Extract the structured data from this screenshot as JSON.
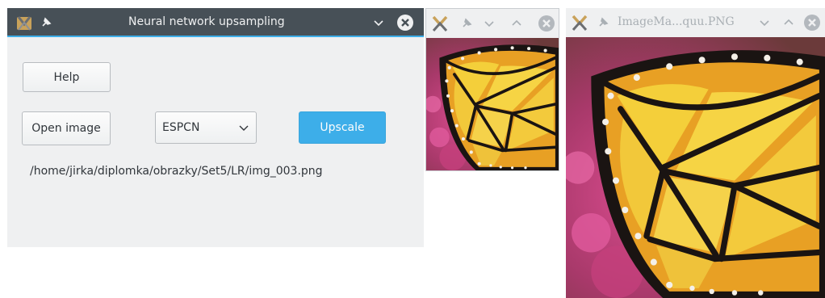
{
  "main_window": {
    "title": "Neural network upsampling",
    "help_button": "Help",
    "open_image_button": "Open image",
    "model_select": {
      "selected": "ESPCN"
    },
    "upscale_button": "Upscale",
    "image_path": "/home/jirka/diplomka/obrazky/Set5/LR/img_003.png"
  },
  "image_window_small": {
    "title": ""
  },
  "image_window_large": {
    "title": "ImageMa...quu.PNG"
  },
  "colors": {
    "accent": "#3daee9",
    "titlebar_dark": "#475057",
    "window_bg": "#eff0f1",
    "text": "#31363b"
  },
  "icons": {
    "app": "kde-app-icon",
    "pin": "pin-icon",
    "minimize": "chevron-down-icon",
    "maximize": "chevron-up-icon",
    "close": "close-circle-icon"
  }
}
